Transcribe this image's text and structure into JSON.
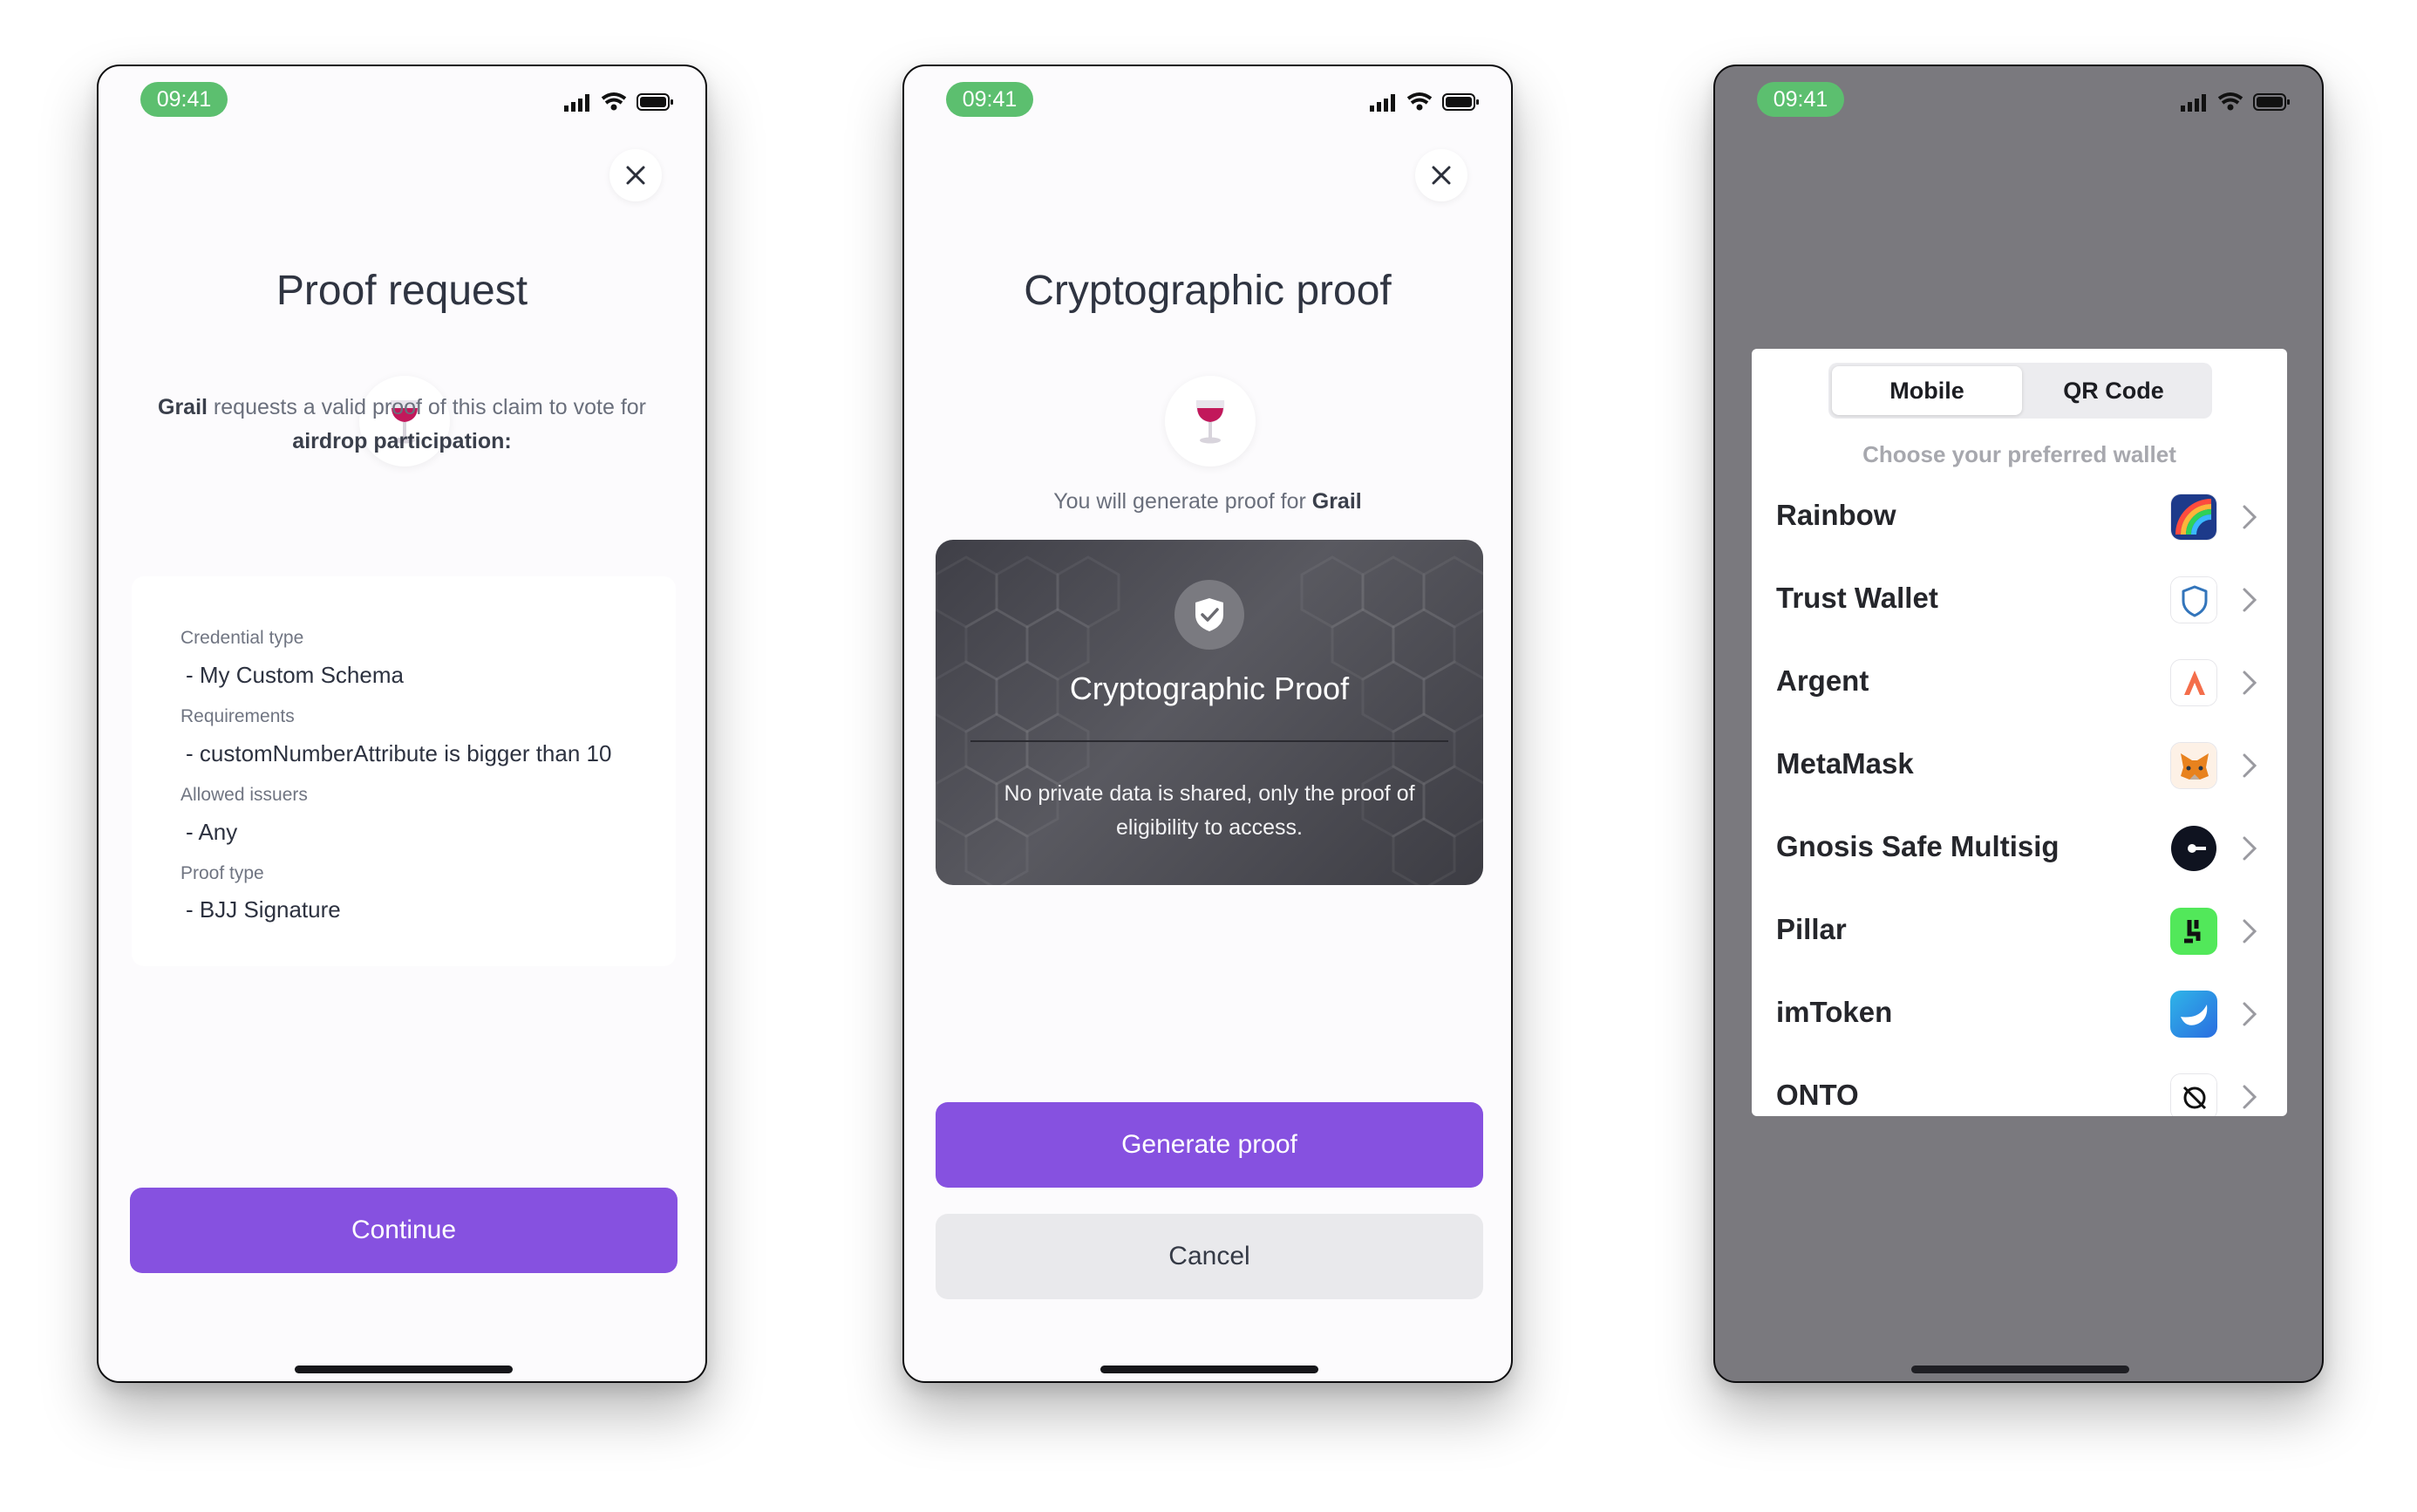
{
  "status": {
    "time": "09:41"
  },
  "screen1": {
    "title": "Proof request",
    "desc_org": "Grail",
    "desc_mid": " requests a valid proof of this claim to vote for ",
    "desc_end": "airdrop participation:",
    "claims": [
      {
        "key": "Credential type",
        "value": "- My Custom Schema"
      },
      {
        "key": "Requirements",
        "value": "- customNumberAttribute is bigger than 10"
      },
      {
        "key": "Allowed issuers",
        "value": "- Any"
      },
      {
        "key": "Proof type",
        "value": "- BJJ Signature"
      }
    ],
    "continue_label": "Continue"
  },
  "screen2": {
    "title": "Cryptographic proof",
    "desc_pre": "You will generate proof for ",
    "desc_org": "Grail",
    "card_title": "Cryptographic Proof",
    "card_text": "No private data is shared, only the proof of eligibility to access.",
    "generate_label": "Generate proof",
    "cancel_label": "Cancel"
  },
  "screen3": {
    "tabs": [
      "Mobile",
      "QR Code"
    ],
    "active_tab": "Mobile",
    "subtitle": "Choose your preferred wallet",
    "wallets": [
      {
        "name": "Rainbow",
        "icon": "rainbow-icon"
      },
      {
        "name": "Trust Wallet",
        "icon": "trust-wallet-shield-icon"
      },
      {
        "name": "Argent",
        "icon": "argent-icon"
      },
      {
        "name": "MetaMask",
        "icon": "metamask-fox-icon"
      },
      {
        "name": "Gnosis Safe Multisig",
        "icon": "gnosis-safe-icon"
      },
      {
        "name": "Pillar",
        "icon": "pillar-icon"
      },
      {
        "name": "imToken",
        "icon": "imtoken-icon"
      },
      {
        "name": "ONTO",
        "icon": "onto-icon"
      }
    ]
  }
}
